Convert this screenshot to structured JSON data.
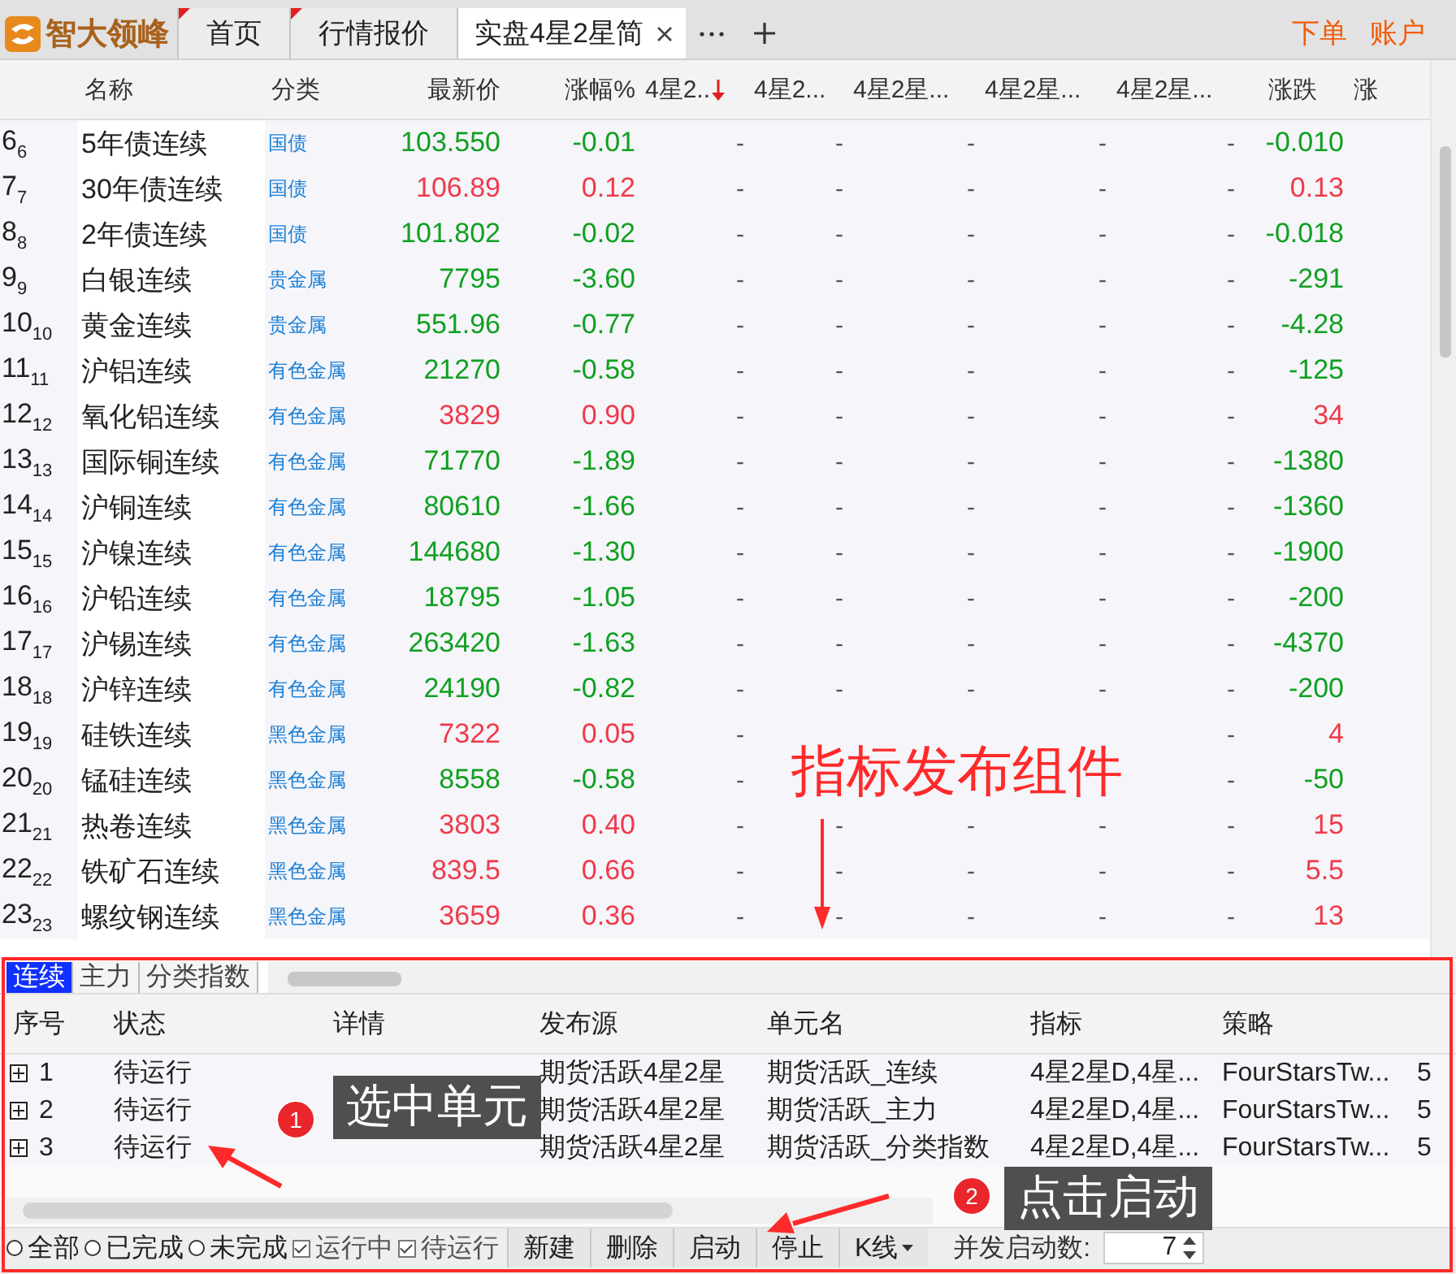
{
  "app": {
    "logo": "智大领峰"
  },
  "tabs": [
    {
      "label": "首页",
      "selected": false,
      "flagged": true
    },
    {
      "label": "行情报价",
      "selected": false,
      "flagged": true
    },
    {
      "label": "实盘4星2星简",
      "selected": true,
      "flagged": false
    }
  ],
  "top_actions": [
    "下单",
    "账户"
  ],
  "quote_table": {
    "columns": [
      {
        "label": "名称",
        "sorted": false
      },
      {
        "label": "分类",
        "sorted": false
      },
      {
        "label": "最新价",
        "sorted": false
      },
      {
        "label": "涨幅%",
        "sorted": false
      },
      {
        "label": "4星2..",
        "sorted": true
      },
      {
        "label": "4星2...",
        "sorted": false
      },
      {
        "label": "4星2星...",
        "sorted": false
      },
      {
        "label": "4星2星...",
        "sorted": false
      },
      {
        "label": "4星2星...",
        "sorted": false
      },
      {
        "label": "涨跌",
        "sorted": false
      },
      {
        "label": "涨",
        "sorted": false
      }
    ],
    "rows": [
      {
        "index": "6$_{6}$",
        "name": "5年债连续",
        "category": "国债",
        "price": "103.550",
        "change_pct": "-0.01",
        "signals": {
          "s1": "-",
          "s2": "-",
          "s3": "-",
          "s4": "-",
          "s5": "-"
        },
        "change": "-0.010",
        "rising": false
      },
      {
        "index": "7$_{7}$",
        "name": "30年债连续",
        "category": "国债",
        "price": "106.89",
        "change_pct": "0.12",
        "signals": {
          "s1": "-",
          "s2": "-",
          "s3": "-",
          "s4": "-",
          "s5": "-"
        },
        "change": "0.13",
        "rising": true
      },
      {
        "index": "8$_{8}$",
        "name": "2年债连续",
        "category": "国债",
        "price": "101.802",
        "change_pct": "-0.02",
        "signals": {
          "s1": "-",
          "s2": "-",
          "s3": "-",
          "s4": "-",
          "s5": "-"
        },
        "change": "-0.018",
        "rising": false
      },
      {
        "index": "9$_{9}$",
        "name": "白银连续",
        "category": "贵金属",
        "price": "7795",
        "change_pct": "-3.60",
        "signals": {
          "s1": "-",
          "s2": "-",
          "s3": "-",
          "s4": "-",
          "s5": "-"
        },
        "change": "-291",
        "rising": false
      },
      {
        "index": "10$_{10}$",
        "name": "黄金连续",
        "category": "贵金属",
        "price": "551.96",
        "change_pct": "-0.77",
        "signals": {
          "s1": "-",
          "s2": "-",
          "s3": "-",
          "s4": "-",
          "s5": "-"
        },
        "change": "-4.28",
        "rising": false
      },
      {
        "index": "11$_{11}$",
        "name": "沪铝连续",
        "category": "有色金属",
        "price": "21270",
        "change_pct": "-0.58",
        "signals": {
          "s1": "-",
          "s2": "-",
          "s3": "-",
          "s4": "-",
          "s5": "-"
        },
        "change": "-125",
        "rising": false
      },
      {
        "index": "12$_{12}$",
        "name": "氧化铝连续",
        "category": "有色金属",
        "price": "3829",
        "change_pct": "0.90",
        "signals": {
          "s1": "-",
          "s2": "-",
          "s3": "-",
          "s4": "-",
          "s5": "-"
        },
        "change": "34",
        "rising": true
      },
      {
        "index": "13$_{13}$",
        "name": "国际铜连续",
        "category": "有色金属",
        "price": "71770",
        "change_pct": "-1.89",
        "signals": {
          "s1": "-",
          "s2": "-",
          "s3": "-",
          "s4": "-",
          "s5": "-"
        },
        "change": "-1380",
        "rising": false
      },
      {
        "index": "14$_{14}$",
        "name": "沪铜连续",
        "category": "有色金属",
        "price": "80610",
        "change_pct": "-1.66",
        "signals": {
          "s1": "-",
          "s2": "-",
          "s3": "-",
          "s4": "-",
          "s5": "-"
        },
        "change": "-1360",
        "rising": false
      },
      {
        "index": "15$_{15}$",
        "name": "沪镍连续",
        "category": "有色金属",
        "price": "144680",
        "change_pct": "-1.30",
        "signals": {
          "s1": "-",
          "s2": "-",
          "s3": "-",
          "s4": "-",
          "s5": "-"
        },
        "change": "-1900",
        "rising": false
      },
      {
        "index": "16$_{16}$",
        "name": "沪铅连续",
        "category": "有色金属",
        "price": "18795",
        "change_pct": "-1.05",
        "signals": {
          "s1": "-",
          "s2": "-",
          "s3": "-",
          "s4": "-",
          "s5": "-"
        },
        "change": "-200",
        "rising": false
      },
      {
        "index": "17$_{17}$",
        "name": "沪锡连续",
        "category": "有色金属",
        "price": "263420",
        "change_pct": "-1.63",
        "signals": {
          "s1": "-",
          "s2": "-",
          "s3": "-",
          "s4": "-",
          "s5": "-"
        },
        "change": "-4370",
        "rising": false
      },
      {
        "index": "18$_{18}$",
        "name": "沪锌连续",
        "category": "有色金属",
        "price": "24190",
        "change_pct": "-0.82",
        "signals": {
          "s1": "-",
          "s2": "-",
          "s3": "-",
          "s4": "-",
          "s5": "-"
        },
        "change": "-200",
        "rising": false
      },
      {
        "index": "19$_{19}$",
        "name": "硅铁连续",
        "category": "黑色金属",
        "price": "7322",
        "change_pct": "0.05",
        "signals": {
          "s1": "-",
          "s5": "-"
        },
        "change": "4",
        "rising": true
      },
      {
        "index": "20$_{20}$",
        "name": "锰硅连续",
        "category": "黑色金属",
        "price": "8558",
        "change_pct": "-0.58",
        "signals": {
          "s1": "-",
          "s5": "-"
        },
        "change": "-50",
        "rising": false
      },
      {
        "index": "21$_{21}$",
        "name": "热卷连续",
        "category": "黑色金属",
        "price": "3803",
        "change_pct": "0.40",
        "signals": {
          "s1": "-",
          "s2": "-",
          "s3": "-",
          "s4": "-",
          "s5": "-"
        },
        "change": "15",
        "rising": true
      },
      {
        "index": "22$_{22}$",
        "name": "铁矿石连续",
        "category": "黑色金属",
        "price": "839.5",
        "change_pct": "0.66",
        "signals": {
          "s1": "-",
          "s2": "-",
          "s3": "-",
          "s4": "-",
          "s5": "-"
        },
        "change": "5.5",
        "rising": true
      },
      {
        "index": "23$_{23}$",
        "name": "螺纹钢连续",
        "category": "黑色金属",
        "price": "3659",
        "change_pct": "0.36",
        "signals": {
          "s1": "-",
          "s2": "-",
          "s3": "-",
          "s4": "-",
          "s5": "-"
        },
        "change": "13",
        "rising": true
      }
    ]
  },
  "publish_panel": {
    "subtabs": [
      {
        "label": "连续",
        "selected": true
      },
      {
        "label": "主力",
        "selected": false
      },
      {
        "label": "分类指数",
        "selected": false
      }
    ],
    "columns": [
      "序号",
      "状态",
      "详情",
      "发布源",
      "单元名",
      "指标",
      "策略"
    ],
    "rows": [
      {
        "expanded": false,
        "number": "1",
        "status": "待运行",
        "source": "期货活跃4星2星",
        "unit": "期货活跃_连续",
        "indicator": "4星2星D,4星...",
        "strategy": "FourStarsTw...",
        "period": "5"
      },
      {
        "expanded": false,
        "number": "2",
        "status": "待运行",
        "source": "期货活跃4星2星",
        "unit": "期货活跃_主力",
        "indicator": "4星2星D,4星...",
        "strategy": "FourStarsTw...",
        "period": "5"
      },
      {
        "expanded": false,
        "number": "3",
        "status": "待运行",
        "source": "期货活跃4星2星",
        "unit": "期货活跃_分类指数",
        "indicator": "4星2星D,4星...",
        "strategy": "FourStarsTw...",
        "period": "5"
      }
    ]
  },
  "status_bar": {
    "filters": [
      {
        "kind": "radio",
        "label": "全部",
        "checked": false
      },
      {
        "kind": "radio",
        "label": "已完成",
        "checked": false
      },
      {
        "kind": "radio",
        "label": "未完成",
        "checked": false
      },
      {
        "kind": "checkbox",
        "label": "运行中",
        "checked": true
      },
      {
        "kind": "checkbox",
        "label": "待运行",
        "checked": true
      }
    ],
    "buttons": [
      {
        "kind": "button",
        "label": "新建"
      },
      {
        "kind": "button",
        "label": "删除"
      },
      {
        "kind": "button",
        "label": "启动"
      },
      {
        "kind": "button",
        "label": "停止"
      },
      {
        "kind": "dropdown",
        "label": "K线"
      }
    ],
    "concurrency": {
      "label": "并发启动数:",
      "value": "7"
    }
  },
  "annotations": {
    "title": "指标发布组件",
    "callouts": [
      {
        "number": "1",
        "text": "选中单元"
      },
      {
        "number": "2",
        "text": "点击启动"
      }
    ]
  }
}
